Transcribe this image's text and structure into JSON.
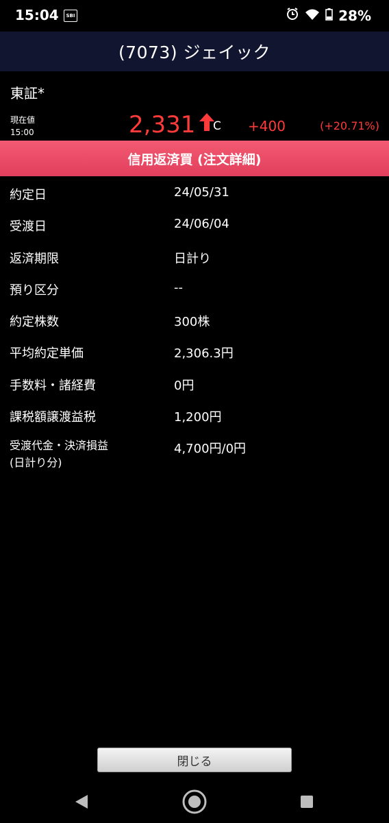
{
  "status_bar": {
    "time": "15:04",
    "carrier_badge": "SBI",
    "battery_pct": "28%",
    "icons": [
      "alarm-icon",
      "wifi-icon",
      "battery-icon"
    ]
  },
  "header": {
    "title": "(7073) ジェイック"
  },
  "quote": {
    "market": "東証*",
    "caption_line1": "現在値",
    "caption_line2": "15:00",
    "price": "2,331",
    "flag": "C",
    "change": "+400",
    "change_pct": "(+20.71%)",
    "up_color": "#ff3a3a"
  },
  "section": {
    "title": "信用返済買 (注文詳細)",
    "color": "#e9485f"
  },
  "details": [
    {
      "label": "約定日",
      "value": "24/05/31"
    },
    {
      "label": "受渡日",
      "value": "24/06/04"
    },
    {
      "label": "返済期限",
      "value": "日計り"
    },
    {
      "label": "預り区分",
      "value": "--"
    },
    {
      "label": "約定株数",
      "value": "300株"
    },
    {
      "label": "平均約定単価",
      "value": "2,306.3円"
    },
    {
      "label": "手数料・諸経費",
      "value": "0円"
    },
    {
      "label": "課税額譲渡益税",
      "value": "1,200円"
    }
  ],
  "settlement": {
    "label_line1": "受渡代金・決済損益",
    "label_line2": "(日計り分)",
    "value": "4,700円/0円"
  },
  "footer": {
    "close_label": "閉じる"
  }
}
